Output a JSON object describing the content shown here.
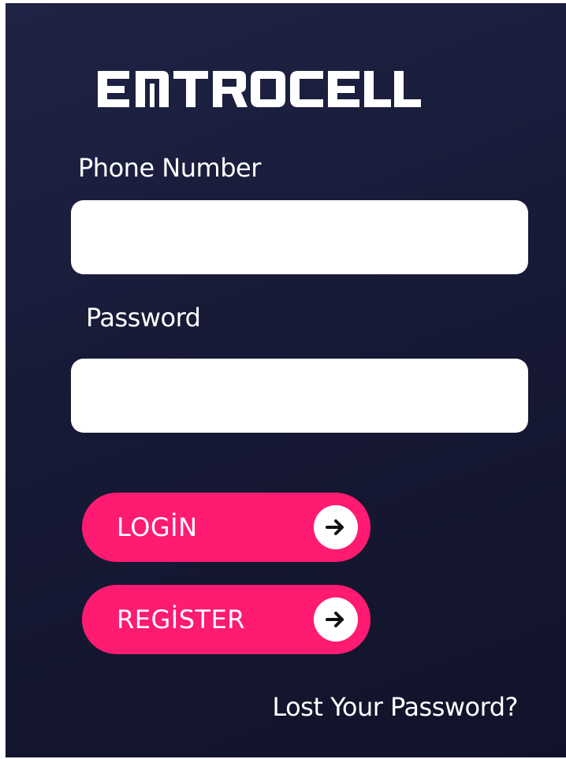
{
  "brand": {
    "logo_text": "ENTROCELL"
  },
  "form": {
    "phone_label": "Phone Number",
    "phone_value": "",
    "password_label": "Password",
    "password_value": ""
  },
  "actions": {
    "login_label": "LOGİN",
    "register_label": "REGİSTER",
    "arrow_icon": "arrow-right-icon",
    "lost_password": "Lost Your Password?"
  },
  "colors": {
    "background": "#1a1d3b",
    "accent": "#ff1a72",
    "text": "#ffffff",
    "field_bg": "#ffffff"
  }
}
